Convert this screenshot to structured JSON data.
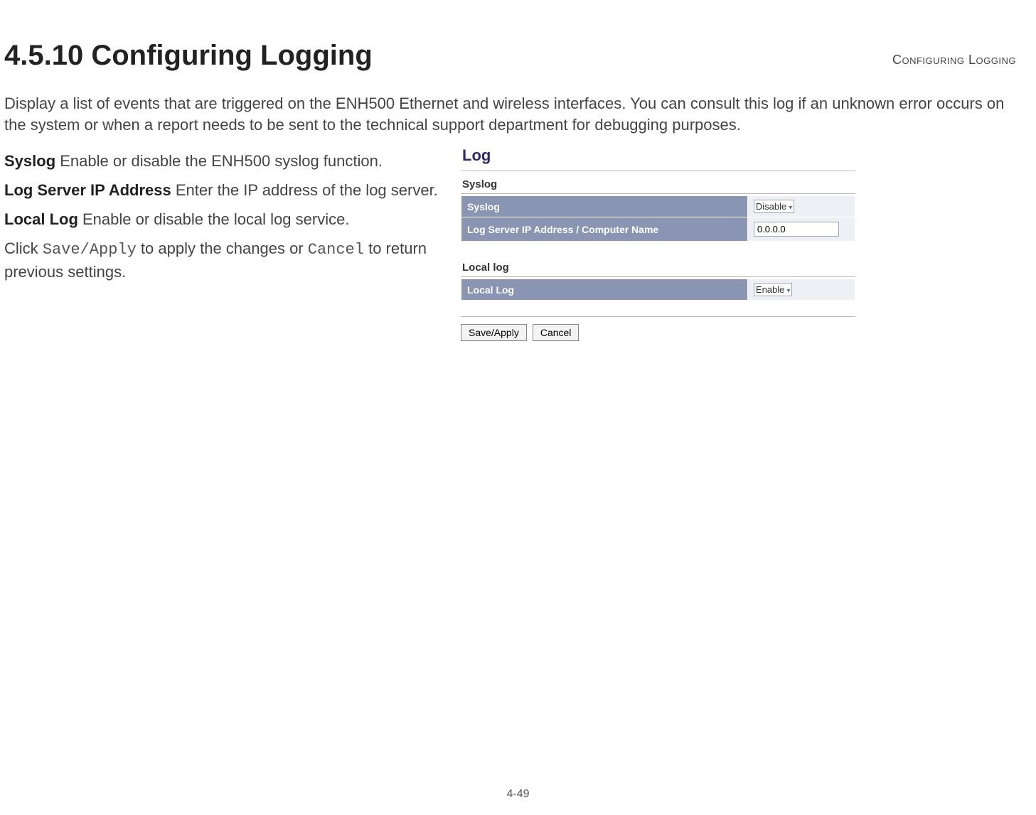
{
  "header": {
    "breadcrumb": "Configuring Logging"
  },
  "section": {
    "heading": "4.5.10 Configuring Logging",
    "intro": "Display a list of events that are triggered on the ENH500 Ethernet and wireless interfaces. You can consult this log if an unknown error occurs on the system or when a report needs to be sent to the technical support department for debugging purposes."
  },
  "definitions": {
    "syslog": {
      "term": "Syslog",
      "desc": "  Enable or disable the ENH500 syslog function."
    },
    "log_server": {
      "term": "Log Server IP Address",
      "desc": "  Enter the IP address of the log server."
    },
    "local_log": {
      "term": "Local Log",
      "desc": "  Enable or disable the local log service."
    },
    "action": {
      "pre": "Click ",
      "btn1": "Save/Apply",
      "mid": " to apply the changes or ",
      "btn2": "Cancel",
      "post": " to return previous settings."
    }
  },
  "panel": {
    "title": "Log",
    "syslog_section": "Syslog",
    "syslog_row_label": "Syslog",
    "syslog_value": "Disable",
    "ip_row_label": "Log Server IP Address / Computer Name",
    "ip_value": "0.0.0.0",
    "local_section": "Local log",
    "local_row_label": "Local Log",
    "local_value": "Enable",
    "buttons": {
      "save": "Save/Apply",
      "cancel": "Cancel"
    }
  },
  "footer": {
    "page": "4-49"
  }
}
